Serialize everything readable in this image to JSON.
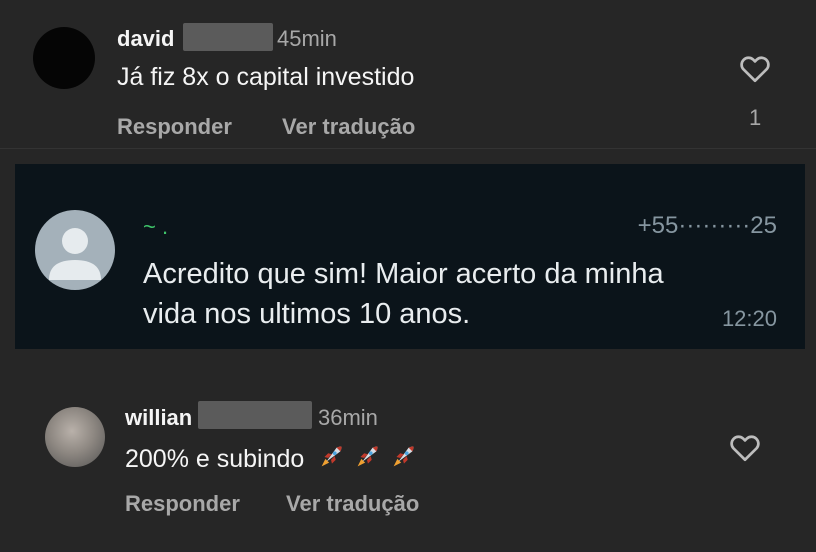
{
  "comments": [
    {
      "username": "david",
      "time": "45min",
      "text": "Já fiz 8x o capital investido",
      "reply_label": "Responder",
      "translate_label": "Ver tradução",
      "like_count": "1"
    },
    {
      "username": "willian",
      "time": "36min",
      "text": "200% e subindo",
      "reply_label": "Responder",
      "translate_label": "Ver tradução"
    }
  ],
  "whatsapp": {
    "sender": "~ .",
    "phone": "+55·········25",
    "message": "Acredito que sim! Maior acerto da minha vida nos ultimos 10 anos.",
    "time": "12:20"
  },
  "icons": {
    "like": "heart-outline-icon",
    "emoji": "rocket-icon"
  },
  "colors": {
    "background": "#262626",
    "whatsapp_bg": "#0b141a",
    "secondary_text": "#a8a8a8"
  }
}
